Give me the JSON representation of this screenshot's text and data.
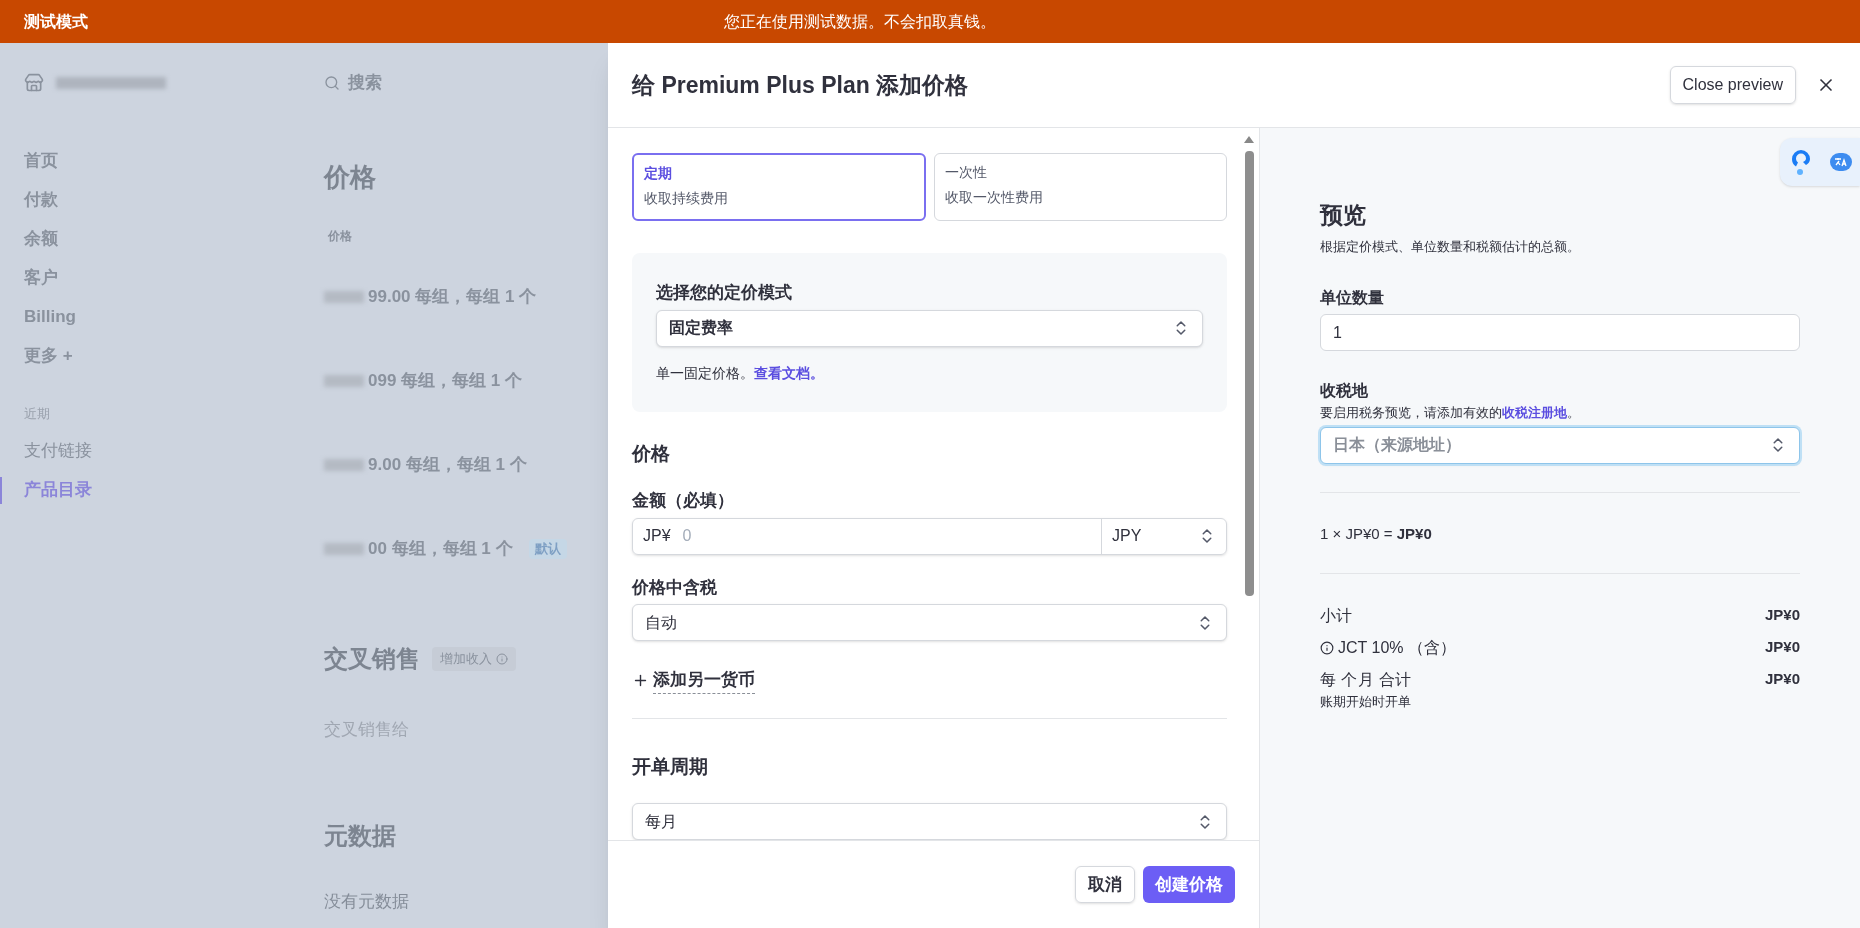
{
  "banner": {
    "mode_label": "测试模式",
    "message": "您正在使用测试数据。不会扣取真钱。"
  },
  "background": {
    "search_placeholder": "搜索",
    "nav_items": [
      {
        "label": "首页",
        "selected": false
      },
      {
        "label": "付款",
        "selected": false
      },
      {
        "label": "余额",
        "selected": false
      },
      {
        "label": "客户",
        "selected": false
      },
      {
        "label": "Billing",
        "selected": false
      },
      {
        "label": "更多 +",
        "selected": false
      }
    ],
    "recent_heading": "近期",
    "recent_items": [
      {
        "label": "支付链接",
        "selected": false
      },
      {
        "label": "产品目录",
        "selected": true
      }
    ],
    "prices_heading": "价格",
    "prices_column": "价格",
    "price_rows": [
      {
        "text": "99.00 每组，每组 1 个"
      },
      {
        "text": "099 每组，每组 1 个"
      },
      {
        "text": "9.00 每组，每组 1 个"
      },
      {
        "text": "00 每组，每组 1 个",
        "badge": "默认"
      }
    ],
    "cross_sell": {
      "title": "交叉销售",
      "badge": "增加收入",
      "text": "交叉销售给"
    },
    "metadata": {
      "title": "元数据",
      "text": "没有元数据"
    }
  },
  "modal": {
    "title": "给 Premium Plus Plan 添加价格",
    "close_preview": "Close preview",
    "type_options": [
      {
        "title": "定期",
        "subtitle": "收取持续费用",
        "selected": true
      },
      {
        "title": "一次性",
        "subtitle": "收取一次性费用",
        "selected": false
      }
    ],
    "pricing_model": {
      "label": "选择您的定价模式",
      "value": "固定费率",
      "help": "单一固定价格。",
      "link": "查看文档。"
    },
    "price_section": {
      "heading": "价格",
      "amount_label": "金额（必填）",
      "currency_prefix": "JP¥",
      "amount_placeholder": "0",
      "currency": "JPY",
      "tax_label": "价格中含税",
      "tax_value": "自动",
      "add_currency": "添加另一货币"
    },
    "billing": {
      "heading": "开单周期",
      "value": "每月"
    },
    "cancel": "取消",
    "create": "创建价格"
  },
  "preview": {
    "title": "预览",
    "subtitle": "根据定价模式、单位数量和税额估计的总额。",
    "quantity_label": "单位数量",
    "quantity_value": "1",
    "tax_label": "收税地",
    "tax_help": "要启用税务预览，请添加有效的",
    "tax_link": "收税注册地",
    "tax_help_end": "。",
    "tax_value": "日本（来源地址）",
    "tax_focused": true,
    "equation": "1 × JP¥0 = **JP¥0**",
    "lines": [
      {
        "kind": "plain",
        "label": "小计",
        "value": "JP¥0"
      },
      {
        "kind": "info",
        "label": "JCT 10% （含）",
        "value": "JP¥0"
      },
      {
        "kind": "total",
        "label": "每 个月 合计",
        "value": "JP¥0",
        "note": "账期开始时开单"
      }
    ]
  }
}
